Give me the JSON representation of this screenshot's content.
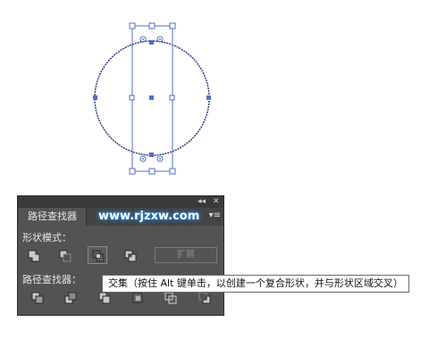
{
  "colors": {
    "selection": "#4f6fc6",
    "path": "#2d3f82",
    "panel_bg": "#535353",
    "panel_dark": "#3a3a3a",
    "text_light": "#e6e6e6",
    "watermark_glow": "#1e90ff"
  },
  "canvas": {
    "artwork": "circle-and-rectangle-selected"
  },
  "panel": {
    "collapse_icon": "double-chevron-left-icon",
    "collapse_glyph": "◂◂",
    "close_glyph": "✕",
    "tab_label": "路径查找器",
    "watermark": "www.rjzxw.com",
    "menu_glyph": "▾≡",
    "shape_modes_label": "形状模式：",
    "shape_modes": [
      {
        "name": "unite",
        "icon": "unite-icon"
      },
      {
        "name": "minus-front",
        "icon": "minus-front-icon"
      },
      {
        "name": "intersect",
        "icon": "intersect-icon",
        "active": true
      },
      {
        "name": "exclude",
        "icon": "exclude-icon"
      }
    ],
    "expand_label": "扩展",
    "pathfinders_label": "路径查找器：",
    "pathfinders": [
      {
        "name": "divide",
        "icon": "divide-icon"
      },
      {
        "name": "trim",
        "icon": "trim-icon"
      },
      {
        "name": "merge",
        "icon": "merge-icon"
      },
      {
        "name": "crop",
        "icon": "crop-icon"
      },
      {
        "name": "outline",
        "icon": "outline-icon"
      },
      {
        "name": "minus-back",
        "icon": "minus-back-icon"
      }
    ]
  },
  "tooltip": {
    "text": "交集（按住 Alt 键单击，以创建一个复合形状，并与形状区域交叉）"
  }
}
